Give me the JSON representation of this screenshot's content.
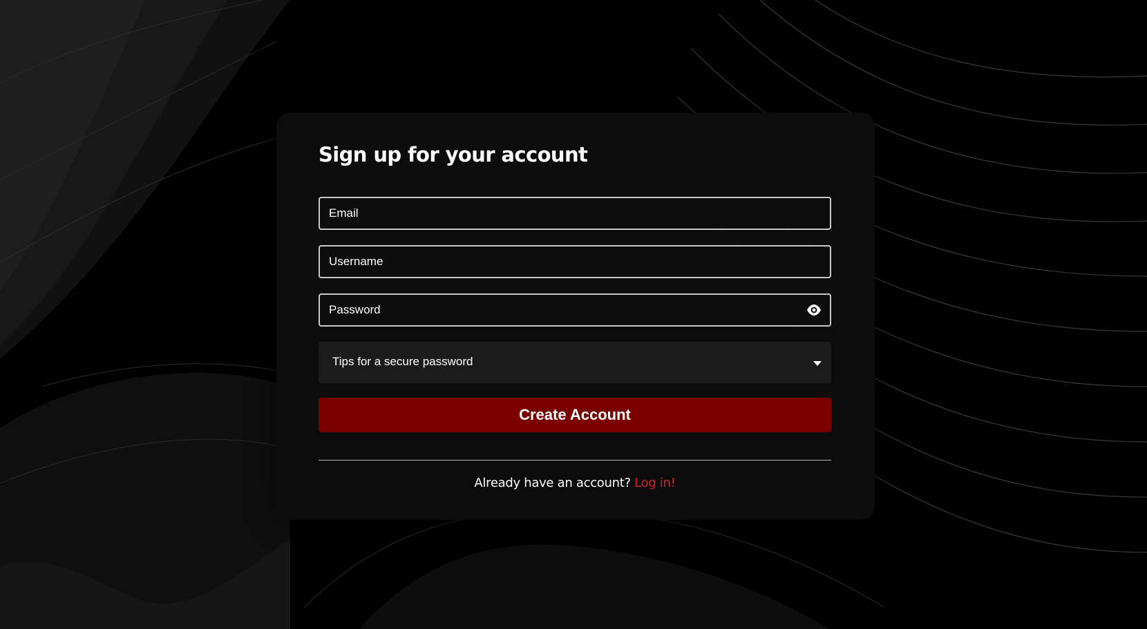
{
  "form": {
    "title": "Sign up for your account",
    "email_placeholder": "Email",
    "username_placeholder": "Username",
    "password_placeholder": "Password",
    "tips_label": "Tips for a secure password",
    "submit_label": "Create Account",
    "footer_text": "Already have an account?",
    "login_link": "Log in!"
  },
  "icons": {
    "password_toggle": "eye-icon",
    "tips_toggle": "caret-down-icon"
  },
  "colors": {
    "background": "#000000",
    "card": "#0c0c0c",
    "field_border": "#c9c9c9",
    "tips_background": "#1b1b1b",
    "primary_button": "#7a0000",
    "link": "#d3222a",
    "text": "#ffffff"
  }
}
